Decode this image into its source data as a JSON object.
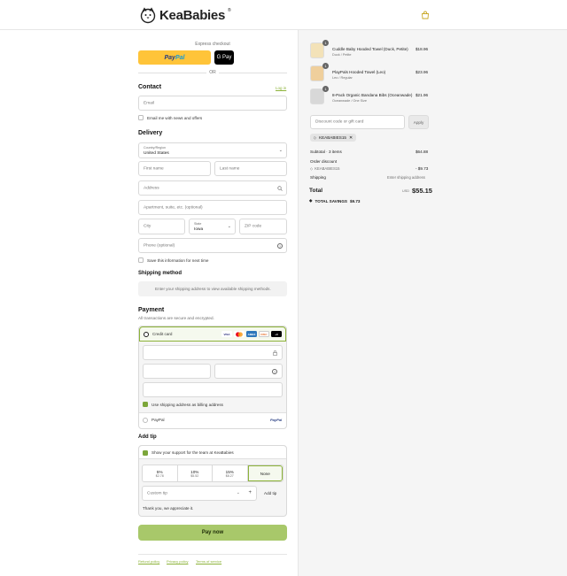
{
  "brand": {
    "name": "KeaBabies",
    "reg": "®"
  },
  "express": {
    "title": "Express checkout",
    "paypal_a": "Pay",
    "paypal_b": "Pal",
    "gpay": "G Pay",
    "or": "OR"
  },
  "contact": {
    "heading": "Contact",
    "login": "Log in",
    "email_placeholder": "Email",
    "news_label": "Email me with news and offers"
  },
  "delivery": {
    "heading": "Delivery",
    "country_label": "Country/Region",
    "country_value": "United States",
    "first_name": "First name",
    "last_name": "Last name",
    "address": "Address",
    "apartment": "Apartment, suite, etc. (optional)",
    "city": "City",
    "state_label": "State",
    "state_value": "Iowa",
    "zip": "ZIP code",
    "phone": "Phone (optional)",
    "save_label": "Save this information for next time"
  },
  "shipping": {
    "heading": "Shipping method",
    "note": "Enter your shipping address to view available shipping methods."
  },
  "payment": {
    "heading": "Payment",
    "subtitle": "All transactions are secure and encrypted.",
    "credit_label": "Credit card",
    "card_logos": [
      "VISA",
      "MC",
      "AMEX",
      "DISC",
      "+3"
    ],
    "billing_label": "Use shipping address as billing address",
    "paypal_label": "PayPal",
    "paypal_logo": "PayPal"
  },
  "tip": {
    "heading": "Add tip",
    "support_label": "Show your support for the team at KeaBabies",
    "options": [
      {
        "pct": "5%",
        "amt": "$2.78"
      },
      {
        "pct": "10%",
        "amt": "$5.52"
      },
      {
        "pct": "15%",
        "amt": "$8.27"
      }
    ],
    "none": "None",
    "custom_placeholder": "Custom tip",
    "add_button": "Add tip",
    "thanks": "Thank you, we appreciate it."
  },
  "pay_now": "Pay now",
  "footer_links": [
    "Refund policy",
    "Privacy policy",
    "Terms of service"
  ],
  "cart": {
    "items": [
      {
        "qty": "1",
        "name": "Cuddle Baby Hooded Towel (Duck, Petite)",
        "variant": "Duck / Petite",
        "price": "$18.96"
      },
      {
        "qty": "1",
        "name": "PlayPals Hooded Towel (Leo)",
        "variant": "Leo / Regular",
        "price": "$23.96"
      },
      {
        "qty": "1",
        "name": "8-Pack Organic Bandana Bibs (Oceanwade)",
        "variant": "Oceanwade / One Size",
        "price": "$21.96"
      }
    ],
    "discount_placeholder": "Discount code or gift card",
    "apply": "Apply",
    "applied_code": "KEABABIES15",
    "subtotal_label": "Subtotal · 3 items",
    "subtotal_value": "$64.88",
    "order_discount_label": "Order discount",
    "discount_code": "KEABABIES15",
    "discount_value": "- $9.73",
    "shipping_label": "Shipping",
    "shipping_value": "Enter shipping address",
    "total_label": "Total",
    "currency": "USD",
    "total_value": "$55.15",
    "savings_label": "TOTAL SAVINGS",
    "savings_value": "$9.73"
  },
  "colors": {
    "accent": "#8db33a",
    "pay_button": "#a8c86a",
    "paypal_yellow": "#ffc439"
  }
}
